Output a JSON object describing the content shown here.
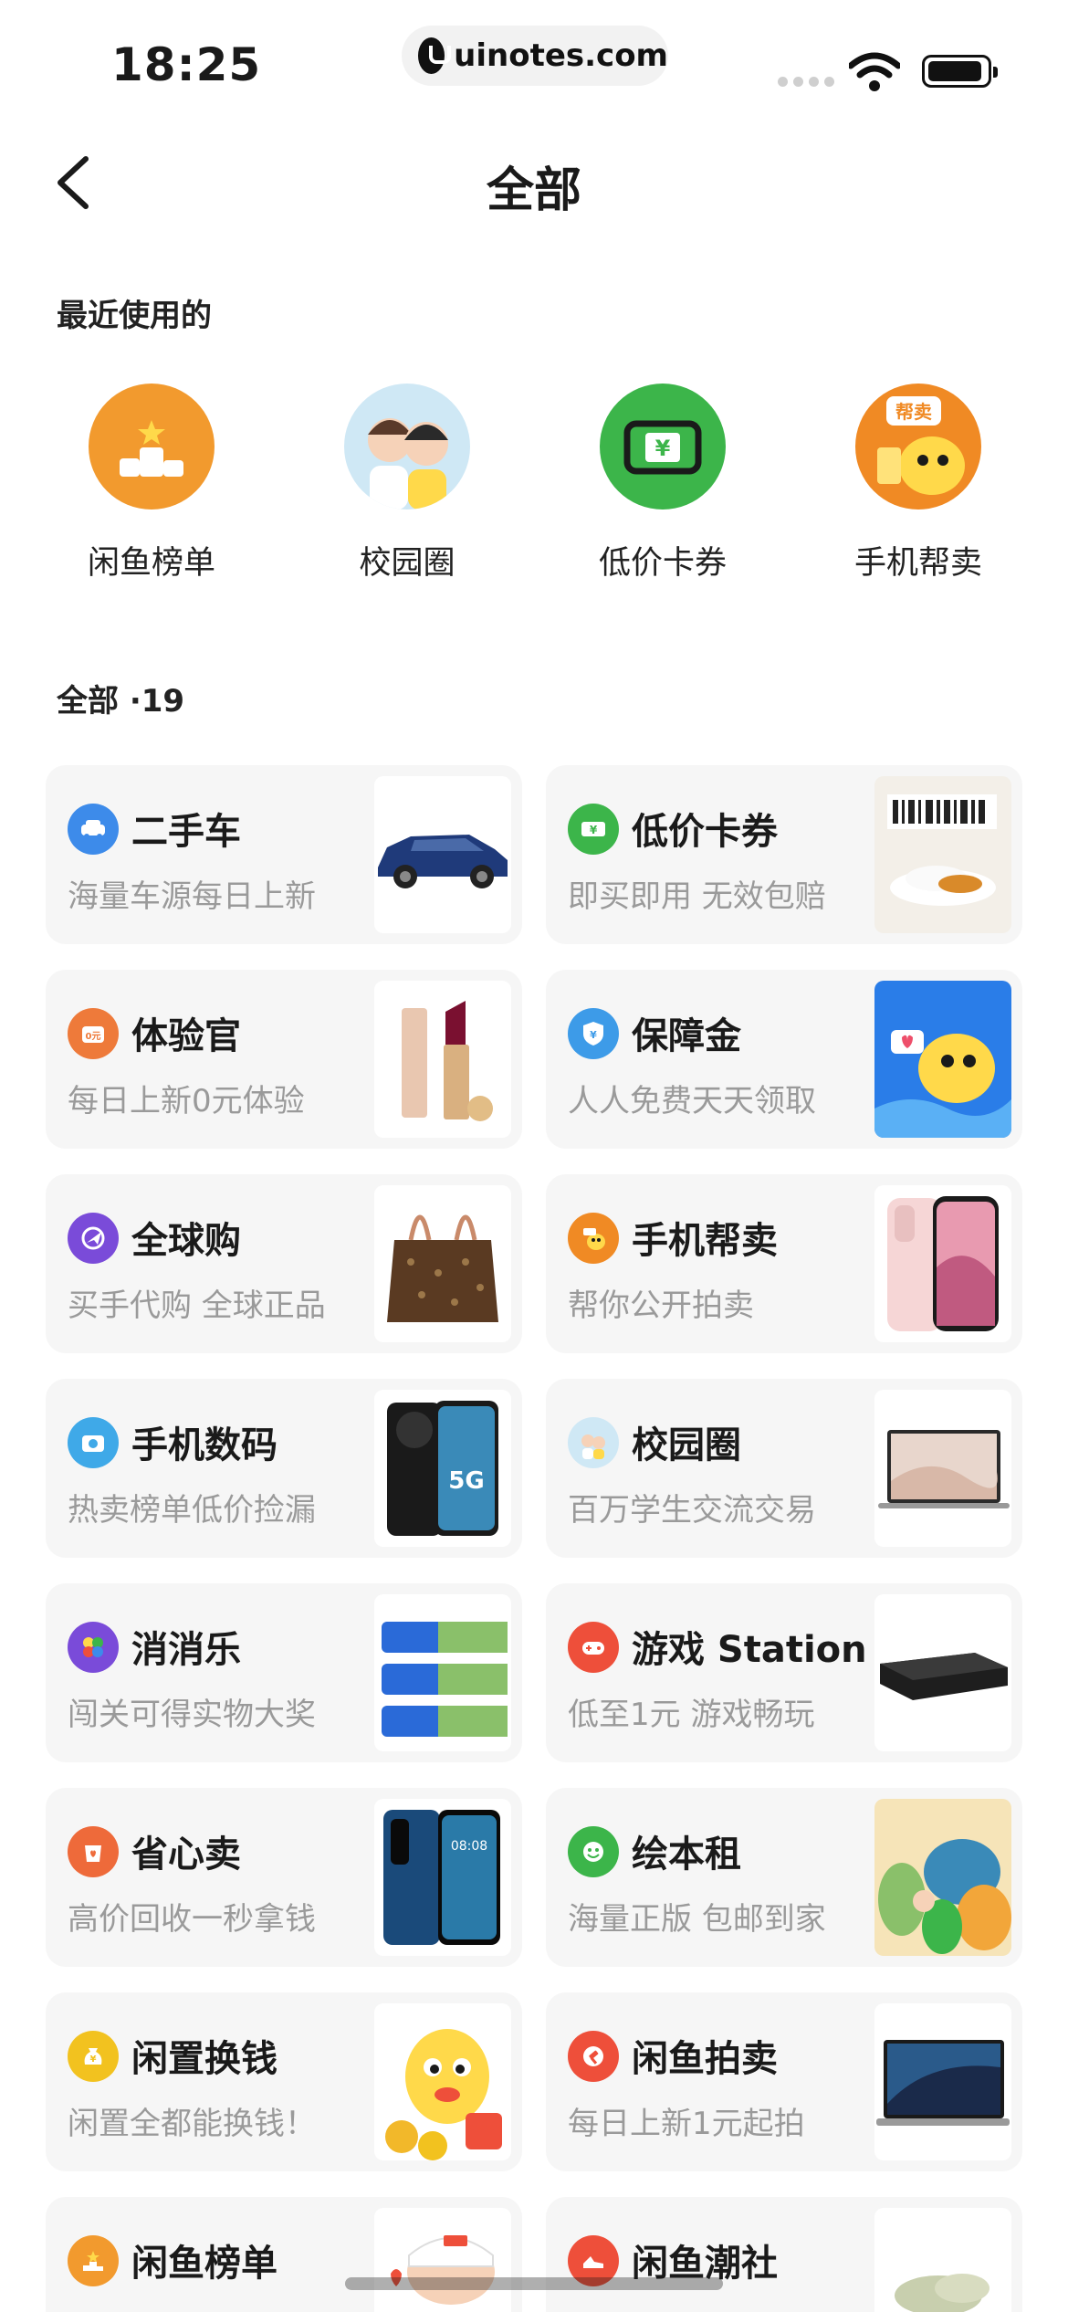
{
  "status_bar": {
    "time": "18:25",
    "url": "uinotes.com"
  },
  "header": {
    "title": "全部"
  },
  "recent": {
    "label": "最近使用的",
    "items": [
      {
        "label": "闲鱼榜单",
        "icon": "podium-icon",
        "color": "#f29a2e"
      },
      {
        "label": "校园圈",
        "icon": "campus-couple-icon",
        "color": "#cfe8f5"
      },
      {
        "label": "低价卡券",
        "icon": "ticket-icon",
        "color": "#3cb54a"
      },
      {
        "label": "手机帮卖",
        "icon": "fish-mascot-icon",
        "color": "#f08a24",
        "badge": "帮卖"
      }
    ]
  },
  "all": {
    "label": "全部 ·19",
    "cards": [
      {
        "title": "二手车",
        "subtitle": "海量车源每日上新",
        "icon": "car-icon",
        "icon_color": "#3d8bea",
        "thumb": "suv-thumb"
      },
      {
        "title": "低价卡券",
        "subtitle": "即买即用 无效包赔",
        "icon": "ticket-icon",
        "icon_color": "#3cb54a",
        "thumb": "voucher-thumb"
      },
      {
        "title": "体验官",
        "subtitle": "每日上新0元体验",
        "icon": "trial-icon",
        "icon_color": "#ee7a3a",
        "badge": "0元",
        "thumb": "lipstick-thumb"
      },
      {
        "title": "保障金",
        "subtitle": "人人免费天天领取",
        "icon": "shield-icon",
        "icon_color": "#3d9be8",
        "thumb": "mascot-blue-thumb"
      },
      {
        "title": "全球购",
        "subtitle": "买手代购 全球正品",
        "icon": "globe-plane-icon",
        "icon_color": "#7a4bd9",
        "thumb": "handbag-thumb"
      },
      {
        "title": "手机帮卖",
        "subtitle": "帮你公开拍卖",
        "icon": "fish-mascot-icon",
        "icon_color": "#f08a24",
        "thumb": "iphone-thumb"
      },
      {
        "title": "手机数码",
        "subtitle": "热卖榜单低价捡漏",
        "icon": "camera-icon",
        "icon_color": "#3fa9e8",
        "thumb": "android-phone-thumb",
        "thumb_text": "5G"
      },
      {
        "title": "校园圈",
        "subtitle": "百万学生交流交易",
        "icon": "campus-couple-icon",
        "icon_color": "#cfe8f5",
        "thumb": "laptop-thumb"
      },
      {
        "title": "消消乐",
        "subtitle": "闯关可得实物大奖",
        "icon": "match-game-icon",
        "icon_color": "#7a4bd9",
        "thumb": "toothpaste-thumb"
      },
      {
        "title": "游戏 Station",
        "subtitle": "低至1元 游戏畅玩",
        "icon": "gamepad-icon",
        "icon_color": "#ee4f3a",
        "thumb": "console-thumb"
      },
      {
        "title": "省心卖",
        "subtitle": "高价回收一秒拿钱",
        "icon": "heart-bag-icon",
        "icon_color": "#ee6a3a",
        "thumb": "huawei-phone-thumb",
        "thumb_text": "08:08"
      },
      {
        "title": "绘本租",
        "subtitle": "海量正版 包邮到家",
        "icon": "smile-book-icon",
        "icon_color": "#3cb54a",
        "thumb": "picture-book-thumb"
      },
      {
        "title": "闲置换钱",
        "subtitle": "闲置全都能换钱！",
        "icon": "money-bag-icon",
        "icon_color": "#f2c21f",
        "thumb": "mascot-coins-thumb"
      },
      {
        "title": "闲鱼拍卖",
        "subtitle": "每日上新1元起拍",
        "icon": "auction-icon",
        "icon_color": "#ee4f3a",
        "thumb": "macbook-thumb"
      },
      {
        "title": "闲鱼榜单",
        "subtitle": "",
        "icon": "podium-icon",
        "icon_color": "#f29a2e",
        "thumb": "mascot-cap-thumb"
      },
      {
        "title": "闲鱼潮社",
        "subtitle": "",
        "icon": "sneaker-icon",
        "icon_color": "#ee4f3a",
        "thumb": "slipper-thumb"
      }
    ]
  }
}
